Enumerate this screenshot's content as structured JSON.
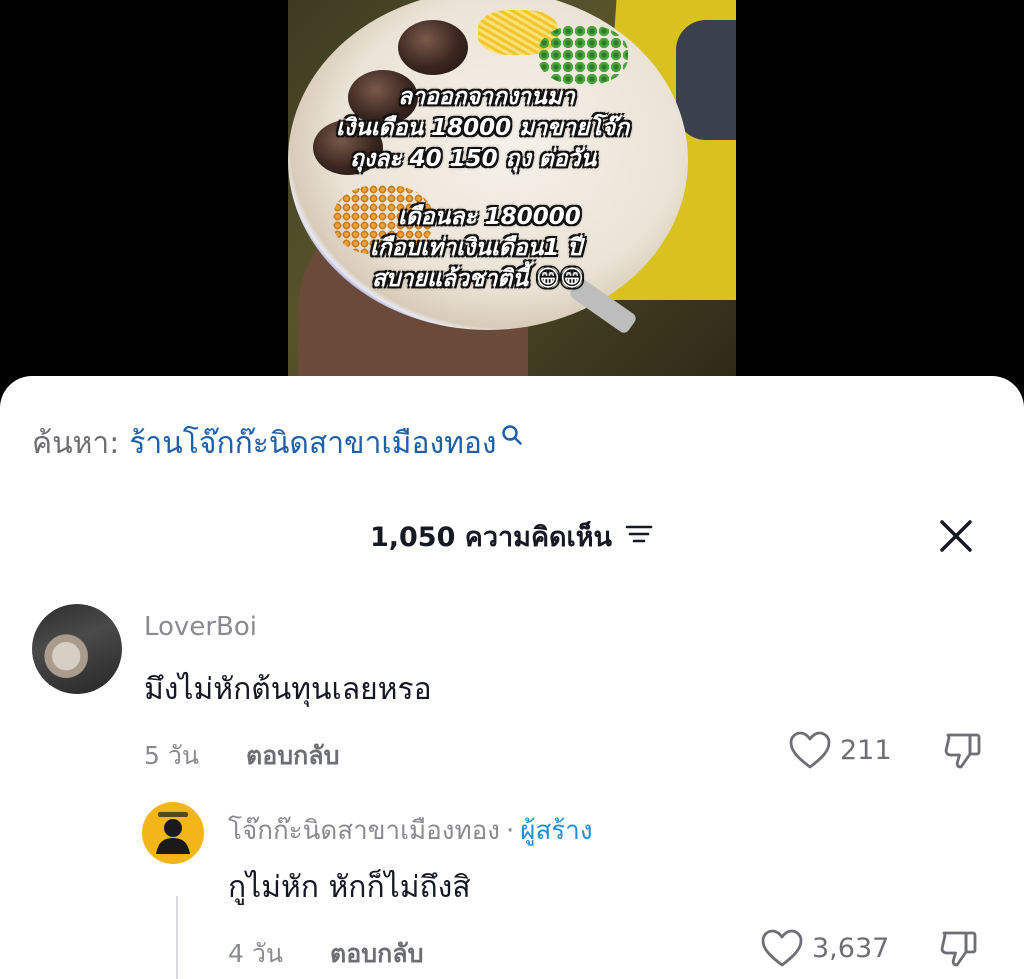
{
  "video_overlay": {
    "lines": [
      "ลาออกจากงานมา",
      "เงินเดือน 18000 มาขายโจ๊ก",
      "ถุงละ 40   150 ถุง ต่อวัน",
      "เดือนละ 180000",
      "เกือบเท่าเงินเดือน1 ปี",
      "สบายแล้วชาตินี้ 😁😁"
    ]
  },
  "search": {
    "prefix": "ค้นหา:",
    "query": "ร้านโจ๊กก๊ะนิดสาขาเมืองทอง"
  },
  "comments_header": {
    "title": "1,050 ความคิดเห็น"
  },
  "comments": [
    {
      "username": "LoverBoi",
      "text": "มึงไม่หักต้นทุนเลยหรอ",
      "time": "5 วัน",
      "reply_label": "ตอบกลับ",
      "likes": "211"
    },
    {
      "username": "โจ๊กก๊ะนิดสาขาเมืองทอง",
      "separator": "·",
      "badge": "ผู้สร้าง",
      "text": "กูไม่หัก หักก็ไม่ถึงสิ",
      "time": "4 วัน",
      "reply_label": "ตอบกลับ",
      "likes": "3,637"
    }
  ],
  "colors": {
    "link": "#1e5fa8",
    "creator_badge": "#1f8fd4",
    "muted": "#8a8b91",
    "text": "#161823"
  }
}
